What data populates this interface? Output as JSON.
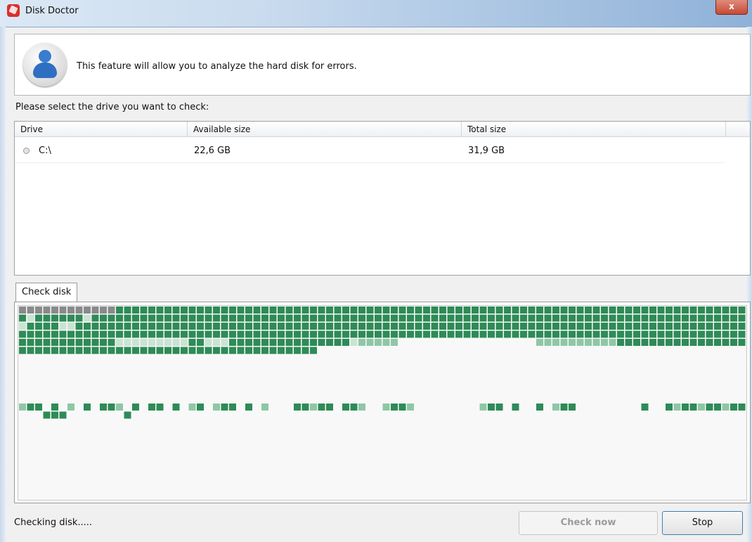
{
  "window": {
    "title": "Disk Doctor",
    "close_label": "x"
  },
  "header": {
    "description": "This feature will allow you to analyze the hard disk for errors."
  },
  "prompt": "Please select the drive you want to check:",
  "drives": {
    "columns": [
      "Drive",
      "Available size",
      "Total size"
    ],
    "rows": [
      {
        "drive": "C:\\",
        "available": "22,6 GB",
        "total": "31,9 GB"
      }
    ]
  },
  "tabs": {
    "check_disk": "Check disk"
  },
  "status": {
    "text": "Checking disk....."
  },
  "buttons": {
    "check_now": "Check now",
    "stop": "Stop"
  },
  "colors": {
    "block_done": "#2e8b57",
    "block_light": "#8fc7a6",
    "block_pale": "#c9e4d3",
    "block_pending": "#8a8a8a"
  }
}
